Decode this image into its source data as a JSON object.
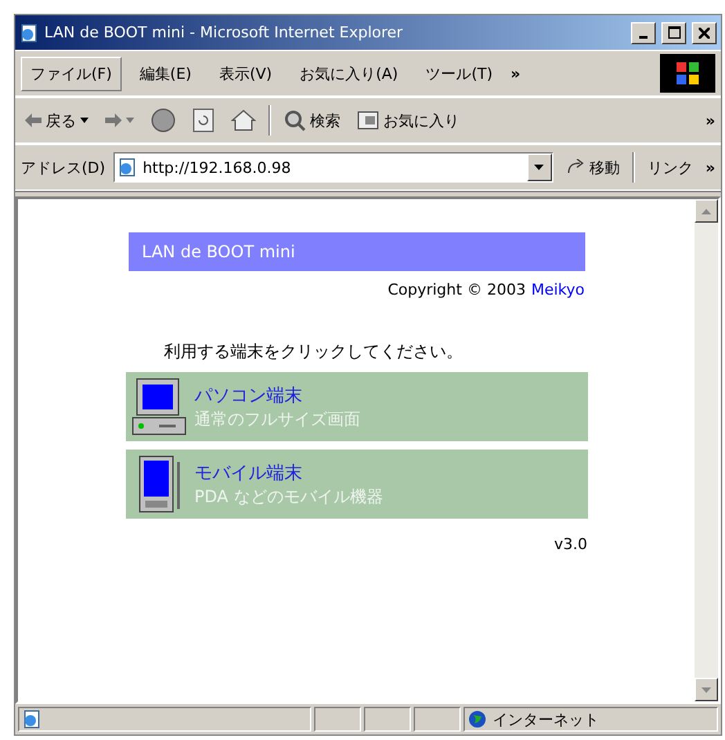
{
  "window": {
    "title": "LAN de BOOT mini - Microsoft Internet Explorer"
  },
  "menu": {
    "items": [
      {
        "label": "ファイル(F)",
        "selected": true
      },
      {
        "label": "編集(E)",
        "selected": false
      },
      {
        "label": "表示(V)",
        "selected": false
      },
      {
        "label": "お気に入り(A)",
        "selected": false
      },
      {
        "label": "ツール(T)",
        "selected": false
      }
    ],
    "more": "»"
  },
  "toolbar": {
    "back": "戻る",
    "search": "検索",
    "favorites": "お気に入り",
    "more": "»"
  },
  "address": {
    "label": "アドレス(D)",
    "url": "http://192.168.0.98",
    "go": "移動",
    "links": "リンク",
    "more": "»"
  },
  "page": {
    "banner": "LAN de BOOT mini",
    "copyright": "Copyright © 2003",
    "company": "Meikyo",
    "instruction": "利用する端末をクリックしてください。",
    "terminals": [
      {
        "kind": "desktop",
        "title": "パソコン端末",
        "description": "通常のフルサイズ画面"
      },
      {
        "kind": "mobile",
        "title": "モバイル端末",
        "description": "PDA などのモバイル機器"
      }
    ],
    "version": "v3.0"
  },
  "status_bar": {
    "zone": "インターネット"
  }
}
